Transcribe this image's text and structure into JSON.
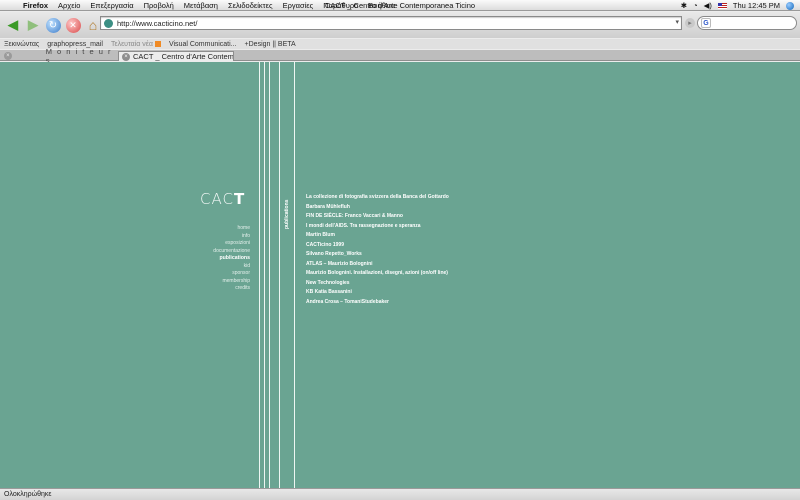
{
  "menubar": {
    "app": "Firefox",
    "items": [
      "Αρχείο",
      "Επεξεργασία",
      "Προβολή",
      "Μετάβαση",
      "Σελιδοδείκτες",
      "Εργασίες",
      "Παράθυρο",
      "Βοήθεια"
    ],
    "window_title": "CACT _ Centro d'Arte Contemporanea Ticino",
    "clock": "Thu 12:45 PM"
  },
  "toolbar": {
    "url": "http://www.cacticino.net/",
    "search_placeholder": ""
  },
  "bookmarks": {
    "items": [
      "Ξεκινώντας",
      "graphopress_mail",
      "Τελευταία νέα",
      "Visual Communicati...",
      "+Design || BETA"
    ]
  },
  "tabs": [
    {
      "label": "M o n i t e u r s"
    },
    {
      "label": "CACT _ Centro d'Arte Contempor..."
    }
  ],
  "site": {
    "logo_light": "CAC",
    "logo_bold": "T",
    "nav": [
      "home",
      "info",
      "esposizioni",
      "documentazione",
      "publications",
      "kid",
      "sponsor",
      "membership",
      "credits"
    ],
    "nav_active_index": 4,
    "section_label": "publications",
    "publications": [
      "La collezione di fotografia svizzera della Banca del Gottardo",
      "Barbara Mühlefluh",
      "FIN DE SIÈCLE: Franco Vaccari & Manno",
      "I mondi dell'AIDS. Tra rassegnazione e speranza",
      "Martin Blum",
      "CACTicino 1999",
      "Silvano Repetto_Works",
      "ATLAS – Maurizio Bolognini",
      "Maurizio Bolognini. Installazioni, disegni, azioni (on/off line)",
      "New Technologies",
      "KB Katia Bassanini",
      "Andrea Crosa – TomaniStudebaker"
    ]
  },
  "statusbar": {
    "text": "Ολοκληρώθηκε"
  },
  "colors": {
    "page_bg": "#6aa492",
    "line": "#eef6f3"
  }
}
